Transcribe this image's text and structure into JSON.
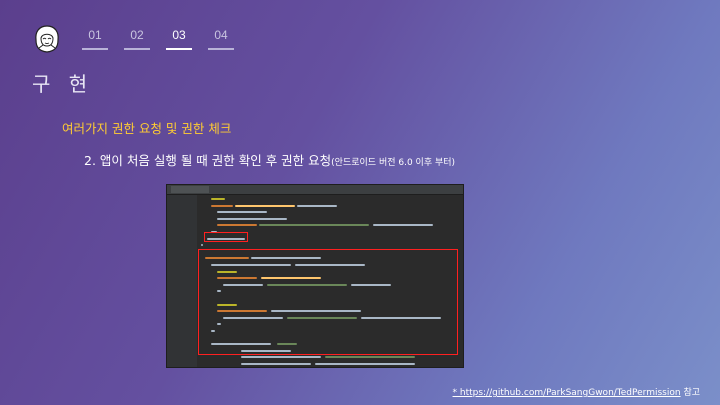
{
  "nav": {
    "items": [
      "01",
      "02",
      "03",
      "04"
    ],
    "active_index": 2
  },
  "slide": {
    "title": "구 현",
    "subtitle": "여러가지 권한 요청 및 권한 체크",
    "description": "2. 앱이 처음 실행 될 때 권한 확인 후 권한 요청",
    "description_note": "(안드로이드 버전 6.0 이후 부터)"
  },
  "footer": {
    "link": "* https://github.com/ParkSangGwon/TedPermission",
    "suffix": " 참고"
  },
  "colors": {
    "accent": "#ffcc33",
    "highlight": "#ff2020",
    "code_bg": "#2b2b2b"
  },
  "icons": {
    "logo": "hooded-character-icon"
  }
}
